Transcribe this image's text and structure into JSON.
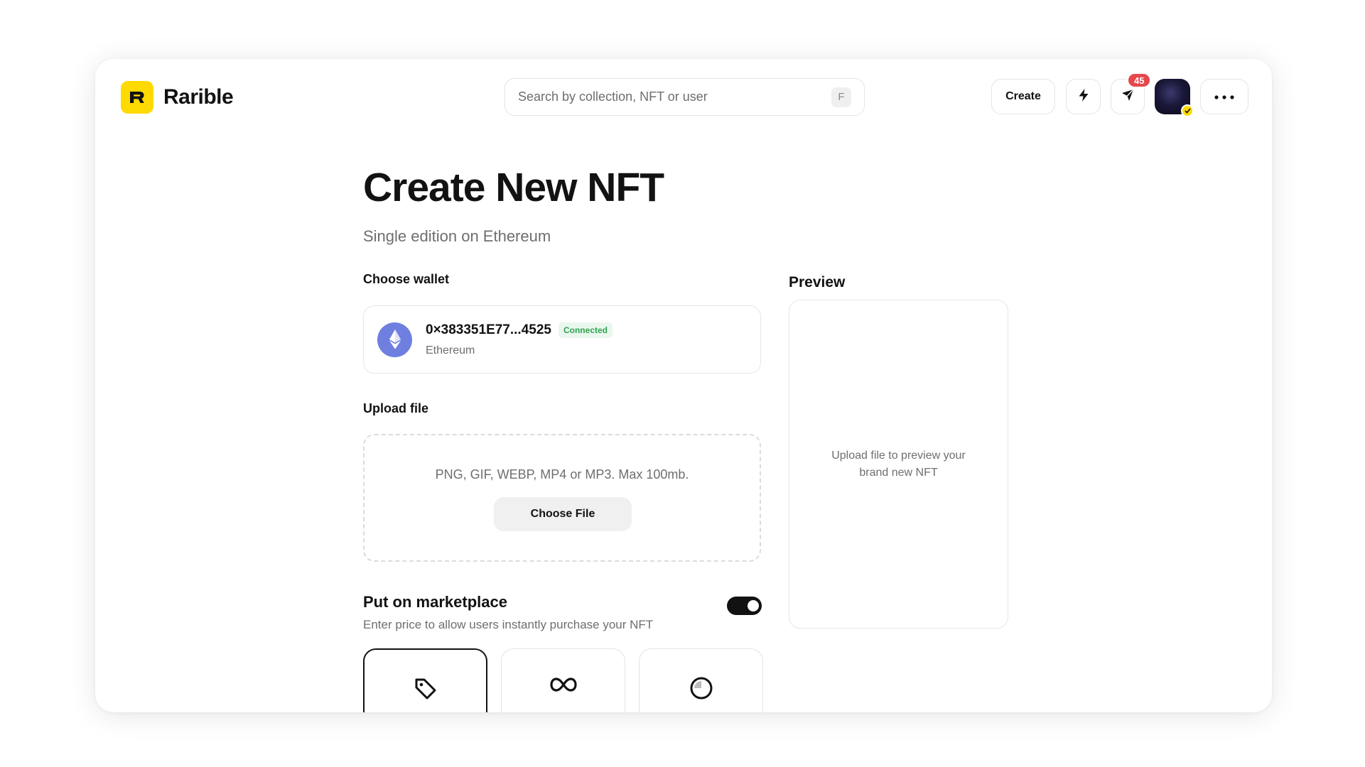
{
  "brand": {
    "name": "Rarible",
    "accent": "#FEDA03"
  },
  "search": {
    "placeholder": "Search by collection, NFT or user",
    "shortcut": "F"
  },
  "header": {
    "create_label": "Create",
    "notification_count": "45"
  },
  "page": {
    "title": "Create New NFT",
    "subtitle": "Single edition on Ethereum"
  },
  "wallet": {
    "label": "Choose wallet",
    "address": "0×383351E77...4525",
    "status": "Connected",
    "network": "Ethereum"
  },
  "upload": {
    "label": "Upload file",
    "formats": "PNG, GIF, WEBP, MP4 or MP3. Max 100mb.",
    "button": "Choose File"
  },
  "marketplace": {
    "title": "Put on marketplace",
    "description": "Enter price to allow users instantly purchase your NFT",
    "enabled": true,
    "options": [
      {
        "icon": "price-tag-icon",
        "selected": true
      },
      {
        "icon": "infinity-icon",
        "selected": false
      },
      {
        "icon": "timed-auction-icon",
        "selected": false
      }
    ]
  },
  "preview": {
    "label": "Preview",
    "placeholder": "Upload file to preview your brand new NFT"
  }
}
